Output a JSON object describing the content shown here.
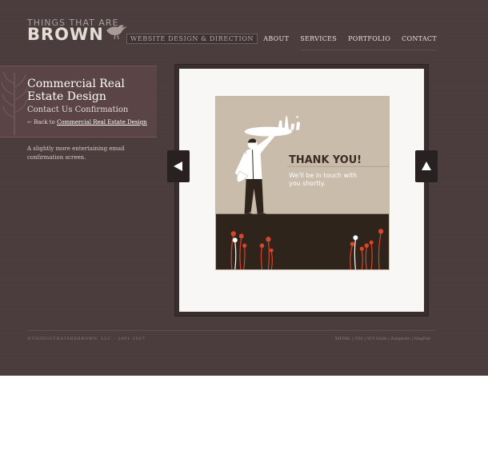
{
  "logo": {
    "top_text": "THINGS THAT ARE",
    "main_text": "BROWN",
    "tagline": "WEBSITE DESIGN & DIRECTION"
  },
  "nav": {
    "items": [
      "ABOUT",
      "SERVICES",
      "PORTFOLIO",
      "CONTACT"
    ]
  },
  "project": {
    "title": "Commercial Real Estate Design",
    "subtitle": "Contact Us Confirmation",
    "back_prefix": "← Back to ",
    "back_link": "Commercial Real Estate Design",
    "description": "A slightly more entertaining email confirmation screen."
  },
  "gallery": {
    "heading": "THANK YOU!",
    "message_line1": "We'll be in touch with",
    "message_line2": "you shortly.",
    "prev_icon": "triangle-left-icon",
    "next_icon": "triangle-up-icon"
  },
  "footer": {
    "copyright": "©THINGSTHATAREBROWN, LLC – 2001-2007",
    "links": [
      "XHTML",
      "CSS",
      "YUI Grids",
      "Zunphoto",
      "NegPub"
    ]
  },
  "colors": {
    "background": "#4a3b3c",
    "panel": "#5b4446",
    "illustration_bg": "#c9bcab",
    "illustration_ground": "#2e241c",
    "flower_red": "#d9452a"
  }
}
